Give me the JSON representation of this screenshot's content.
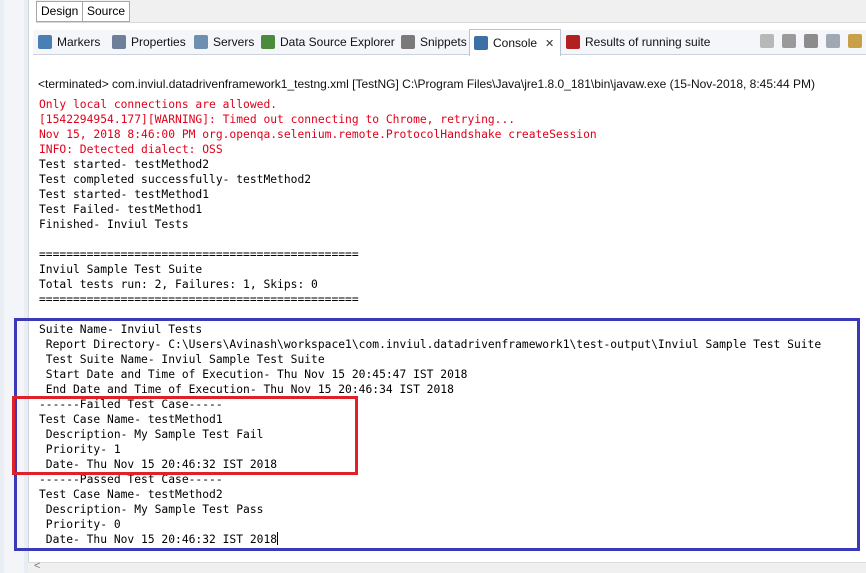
{
  "design_tabs": [
    {
      "label": "Design"
    },
    {
      "label": "Source"
    }
  ],
  "view_tabs": [
    {
      "label": "Markers",
      "icon": "markers-icon",
      "color": "#4a7fb5"
    },
    {
      "label": "Properties",
      "icon": "properties-icon",
      "color": "#6d7f99"
    },
    {
      "label": "Servers",
      "icon": "servers-icon",
      "color": "#6f8fb0"
    },
    {
      "label": "Data Source Explorer",
      "icon": "data-source-explorer-icon",
      "color": "#4c8a3c"
    },
    {
      "label": "Snippets",
      "icon": "snippets-icon",
      "color": "#7a7a7a"
    },
    {
      "label": "Console",
      "icon": "console-icon",
      "color": "#3c6fa6",
      "active": true,
      "close": "✕"
    },
    {
      "label": "Results of running suite",
      "icon": "testng-results-icon",
      "color": "#b32020"
    }
  ],
  "status_line": "<terminated> com.inviul.datadrivenframework1_testng.xml [TestNG] C:\\Program Files\\Java\\jre1.8.0_181\\bin\\javaw.exe (15-Nov-2018, 8:45:44 PM)",
  "console_lines": [
    {
      "text": "Only local connections are allowed.",
      "color": "red"
    },
    {
      "text": "[1542294954.177][WARNING]: Timed out connecting to Chrome, retrying...",
      "color": "red"
    },
    {
      "text": "Nov 15, 2018 8:46:00 PM org.openqa.selenium.remote.ProtocolHandshake createSession",
      "color": "red"
    },
    {
      "text": "INFO: Detected dialect: OSS",
      "color": "red"
    },
    {
      "text": "Test started- testMethod2",
      "color": "black"
    },
    {
      "text": "Test completed successfully- testMethod2",
      "color": "black"
    },
    {
      "text": "Test started- testMethod1",
      "color": "black"
    },
    {
      "text": "Test Failed- testMethod1",
      "color": "black"
    },
    {
      "text": "Finished- Inviul Tests",
      "color": "black"
    },
    {
      "text": "",
      "color": "black"
    },
    {
      "text": "===============================================",
      "color": "black"
    },
    {
      "text": "Inviul Sample Test Suite",
      "color": "black"
    },
    {
      "text": "Total tests run: 2, Failures: 1, Skips: 0",
      "color": "black"
    },
    {
      "text": "===============================================",
      "color": "black"
    },
    {
      "text": "",
      "color": "black"
    },
    {
      "text": "Suite Name- Inviul Tests",
      "color": "black"
    },
    {
      "text": " Report Directory- C:\\Users\\Avinash\\workspace1\\com.inviul.datadrivenframework1\\test-output\\Inviul Sample Test Suite",
      "color": "black"
    },
    {
      "text": " Test Suite Name- Inviul Sample Test Suite",
      "color": "black"
    },
    {
      "text": " Start Date and Time of Execution- Thu Nov 15 20:45:47 IST 2018",
      "color": "black"
    },
    {
      "text": " End Date and Time of Execution- Thu Nov 15 20:46:34 IST 2018",
      "color": "black"
    },
    {
      "text": "------Failed Test Case-----",
      "color": "black"
    },
    {
      "text": "Test Case Name- testMethod1",
      "color": "black"
    },
    {
      "text": " Description- My Sample Test Fail",
      "color": "black"
    },
    {
      "text": " Priority- 1",
      "color": "black"
    },
    {
      "text": " Date- Thu Nov 15 20:46:32 IST 2018",
      "color": "black"
    },
    {
      "text": "------Passed Test Case-----",
      "color": "black"
    },
    {
      "text": "Test Case Name- testMethod2",
      "color": "black"
    },
    {
      "text": " Description- My Sample Test Pass",
      "color": "black"
    },
    {
      "text": " Priority- 0",
      "color": "black"
    },
    {
      "text": " Date- Thu Nov 15 20:46:32 IST 2018",
      "color": "black"
    }
  ],
  "toolbar_icons": [
    "terminate-icon",
    "remove-launch-icon",
    "remove-all-icon",
    "scroll-lock-icon",
    "pin-console-icon"
  ],
  "highlight_colors": {
    "suite_box": "#3a3ab8",
    "failed_box": "#e0202a"
  }
}
